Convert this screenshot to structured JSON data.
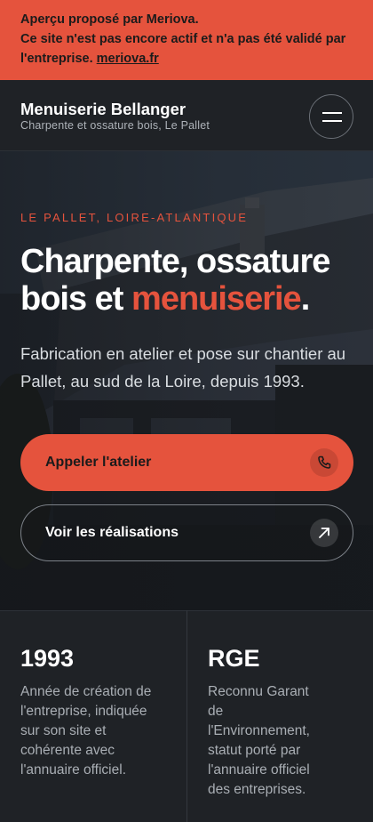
{
  "banner": {
    "line1": "Aperçu proposé par Meriova.",
    "line2": "Ce site n'est pas encore actif et n'a pas été validé par l'entreprise.",
    "link": "meriova.fr"
  },
  "header": {
    "brand_name": "Menuiserie Bellanger",
    "brand_sub": "Charpente et ossature bois, Le Pallet",
    "menu_icon": "hamburger-menu-icon"
  },
  "hero": {
    "eyebrow": "LE PALLET, LOIRE-ATLANTIQUE",
    "title_part1": "Charpente, ossature bois et ",
    "title_accent": "menuiserie",
    "title_end": ".",
    "description": "Fabrication en atelier et pose sur chantier au Pallet, au sud de la Loire, depuis 1993.",
    "cta_primary": {
      "label": "Appeler l'atelier",
      "icon": "phone-icon"
    },
    "cta_secondary": {
      "label": "Voir les réalisations",
      "icon": "arrow-up-right-icon"
    }
  },
  "stats": [
    {
      "value": "1993",
      "text": "Année de création de l'entreprise, indiquée sur son site et cohérente avec l'annuaire officiel."
    },
    {
      "value": "RGE",
      "text": "Reconnu Garant de l'Environnement, statut porté par l'annuaire officiel des entreprises."
    }
  ],
  "colors": {
    "accent": "#e5533d",
    "background": "#1f2226",
    "text_muted": "#a9aeb4"
  }
}
